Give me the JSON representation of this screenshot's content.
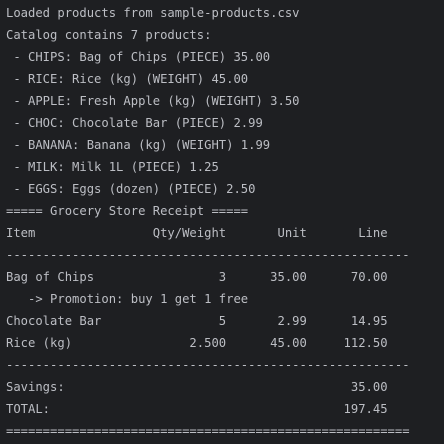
{
  "console": {
    "lines": [
      "Loaded products from sample-products.csv",
      "Catalog contains 7 products:",
      " - CHIPS: Bag of Chips (PIECE) 35.00",
      " - RICE: Rice (kg) (WEIGHT) 45.00",
      " - APPLE: Fresh Apple (kg) (WEIGHT) 3.50",
      " - CHOC: Chocolate Bar (PIECE) 2.99",
      " - BANANA: Banana (kg) (WEIGHT) 1.99",
      " - MILK: Milk 1L (PIECE) 1.25",
      " - EGGS: Eggs (dozen) (PIECE) 2.50",
      "===== Grocery Store Receipt =====",
      "Item                Qty/Weight       Unit       Line",
      "-------------------------------------------------------",
      "Bag of Chips                 3      35.00      70.00",
      "   -> Promotion: buy 1 get 1 free",
      "Chocolate Bar                5       2.99      14.95",
      "Rice (kg)                2.500      45.00     112.50",
      "-------------------------------------------------------",
      "Savings:                                       35.00",
      "TOTAL:                                        197.45",
      "======================================================="
    ]
  }
}
